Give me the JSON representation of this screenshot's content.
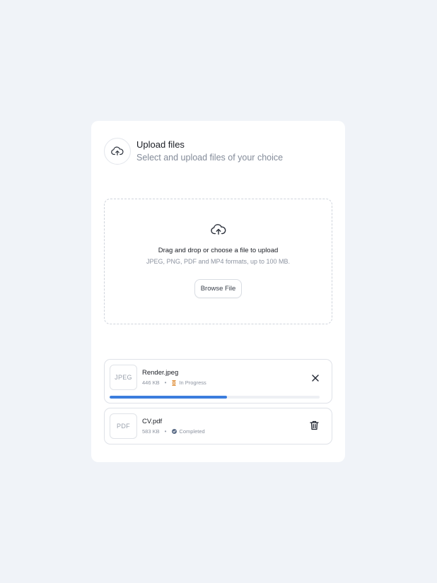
{
  "header": {
    "icon": "cloud-upload-icon",
    "title": "Upload files",
    "subtitle": "Select and upload files of your choice"
  },
  "dropzone": {
    "icon": "cloud-upload-icon",
    "instruction": "Drag and drop or choose a file to upload",
    "formats": "JPEG, PNG, PDF and MP4 formats, up to 100 MB.",
    "button_label": "Browse File"
  },
  "files": [
    {
      "type_label": "JPEG",
      "name": "Render.jpeg",
      "size": "446 KB",
      "status": "In Progress",
      "status_icon": "hourglass-icon",
      "status_color": "#e0913c",
      "progress": 0.56,
      "action_icon": "close-icon"
    },
    {
      "type_label": "PDF",
      "name": "CV.pdf",
      "size": "583 KB",
      "status": "Completed",
      "status_icon": "check-circle-icon",
      "status_color": "#5a6b86",
      "action_icon": "trash-icon"
    }
  ],
  "colors": {
    "background": "#f0f3f8",
    "accent": "#3b7ddd"
  }
}
